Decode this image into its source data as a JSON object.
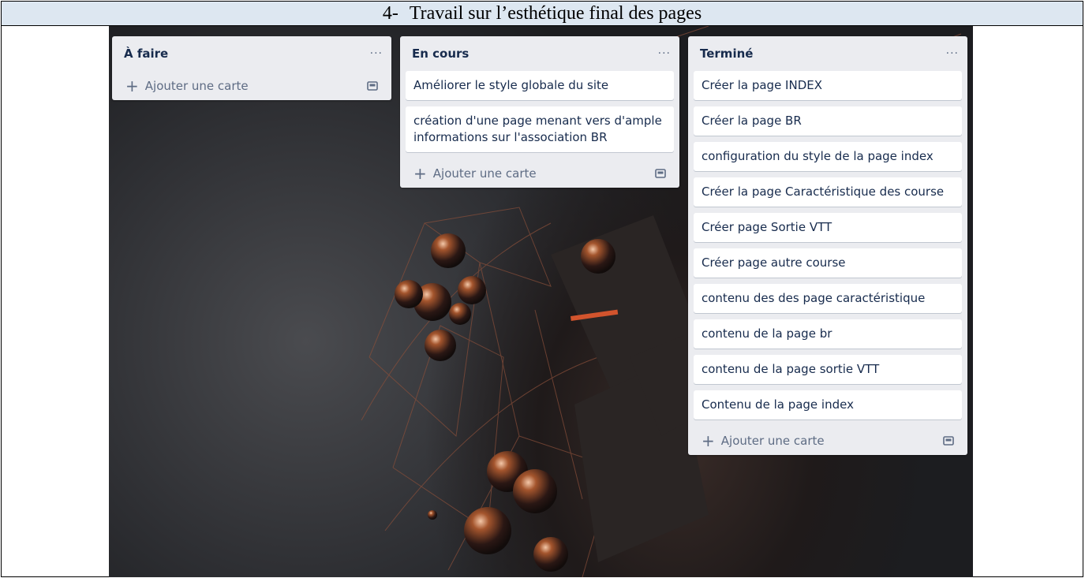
{
  "document": {
    "caption_number": "4-",
    "caption_text": "Travail sur l’esthétique final des pages"
  },
  "lists": [
    {
      "title": "À faire",
      "menu": "···",
      "cards": [],
      "add_card_label": "Ajouter une carte"
    },
    {
      "title": "En cours",
      "menu": "···",
      "cards": [
        "Améliorer le style globale du site",
        "création d'une page menant vers d'ample informations sur l'association BR"
      ],
      "add_card_label": "Ajouter une carte"
    },
    {
      "title": "Terminé",
      "menu": "···",
      "cards": [
        "Créer la page INDEX",
        "Créer la page BR",
        "configuration du style de la page index",
        "Créer la page Caractéristique des course",
        "Créer page Sortie VTT",
        "Créer page autre course",
        "contenu des des page caractéristique",
        "contenu de la page br",
        "contenu de la page sortie VTT",
        "Contenu de la page index"
      ],
      "add_card_label": "Ajouter une carte"
    }
  ],
  "icons": {
    "add": "plus-icon",
    "template": "card-template-icon",
    "menu": "more-horizontal-icon"
  },
  "colors": {
    "list_bg": "#ebecf0",
    "card_bg": "#ffffff",
    "text": "#172b4d",
    "muted": "#5e6c84",
    "caption_bg": "#dde7f1"
  }
}
